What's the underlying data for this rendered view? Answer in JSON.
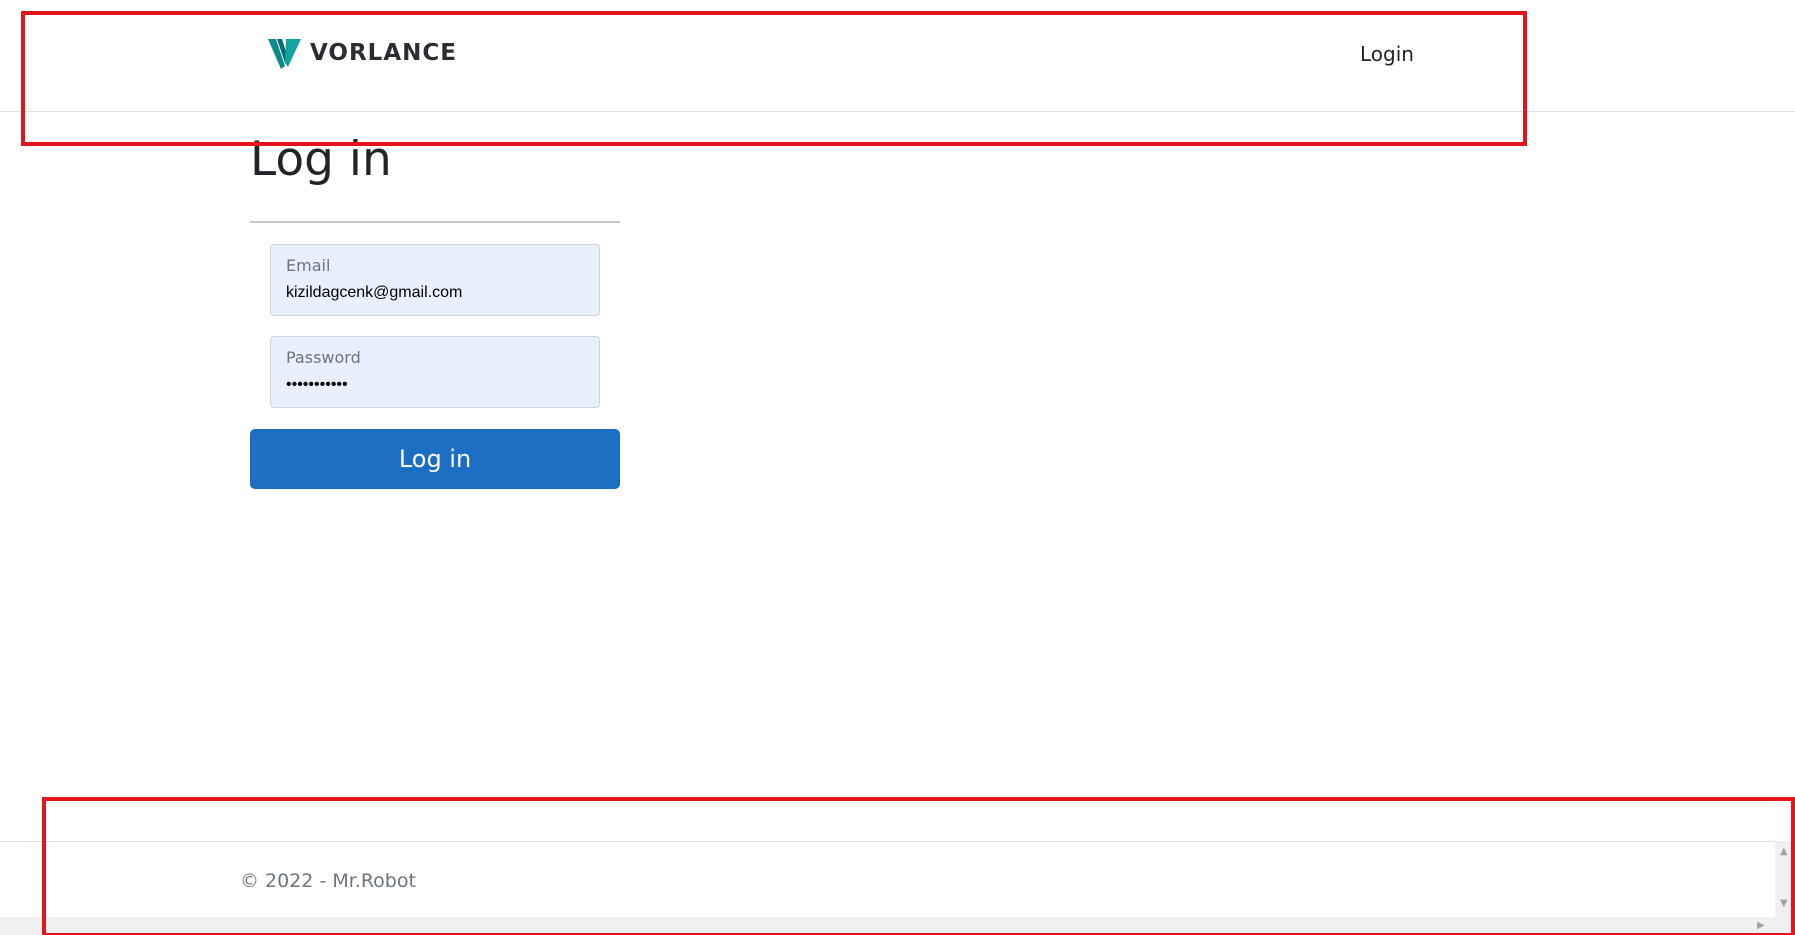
{
  "header": {
    "brand_name": "VORLANCE",
    "nav_login": "Login"
  },
  "main": {
    "title": "Log in",
    "email": {
      "label": "Email",
      "value": "kizildagcenk@gmail.com"
    },
    "password": {
      "label": "Password",
      "value": "•••••••••••"
    },
    "submit_label": "Log in"
  },
  "footer": {
    "text": "© 2022 - Mr.Robot"
  },
  "colors": {
    "primary": "#1b6ec2",
    "brand_teal": "#0f8a8a",
    "annotation": "#e3141b",
    "field_bg": "#e8f0fe"
  },
  "icons": {
    "brand": "vorlance-logo-icon",
    "scroll_up": "arrow-up-icon",
    "scroll_down": "arrow-down-icon",
    "scroll_right": "arrow-right-icon"
  }
}
